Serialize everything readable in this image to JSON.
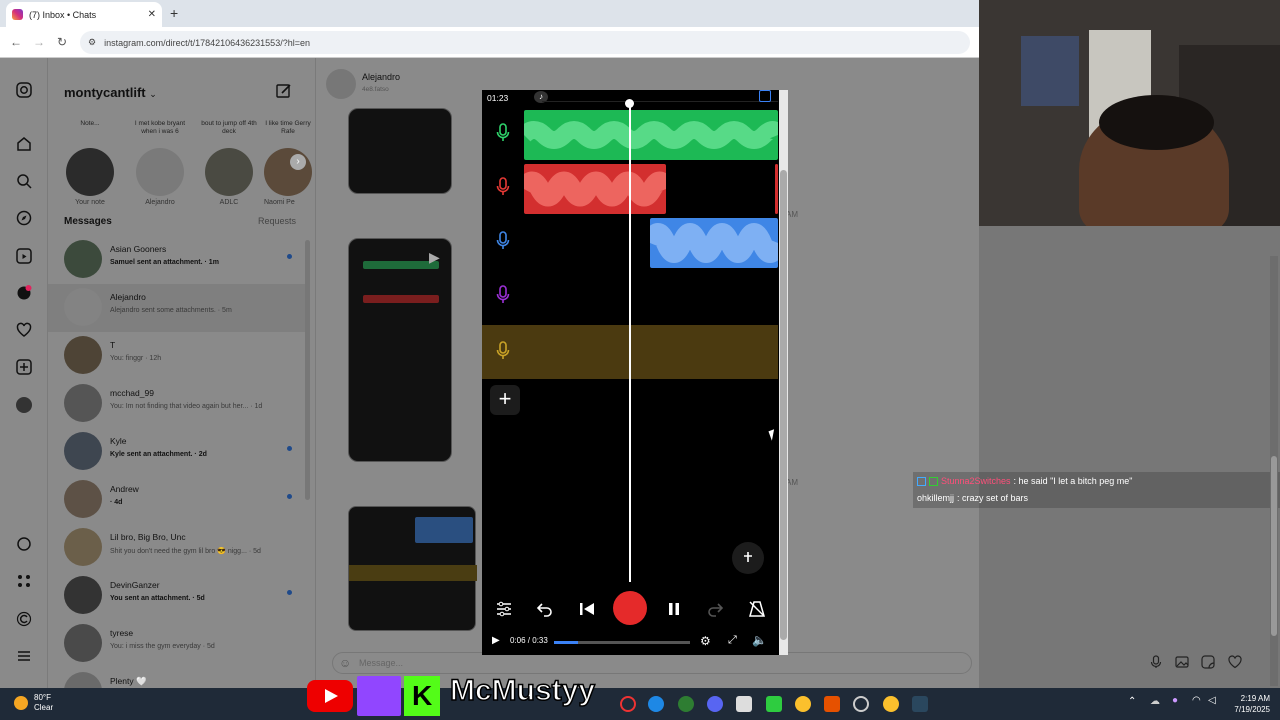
{
  "browser": {
    "tab_title": "(7) Inbox • Chats",
    "url": "instagram.com/direct/t/17842106436231553/?hl=en"
  },
  "sidebar": {
    "username": "montycantlift",
    "notes": [
      {
        "bubble": "Note...",
        "name": "Your note"
      },
      {
        "bubble": "I met kobe bryant when i was 6",
        "name": "Alejandro"
      },
      {
        "bubble": "bout to jump off 4th deck",
        "name": "ADLC"
      },
      {
        "bubble": "I like time Gerry Rafe",
        "name": "Naomi Pe"
      }
    ],
    "messages_label": "Messages",
    "requests_label": "Requests",
    "chats": [
      {
        "name": "Asian Gooners",
        "preview": "Samuel sent an attachment. · 1m",
        "unread": true
      },
      {
        "name": "Alejandro",
        "preview": "Alejandro sent some attachments. · 5m",
        "unread": false
      },
      {
        "name": "T",
        "preview": "You: finggr · 12h",
        "unread": false
      },
      {
        "name": "mcchad_99",
        "preview": "You: Im not finding that video again but her... · 1d",
        "unread": false
      },
      {
        "name": "Kyle",
        "preview": "Kyle sent an attachment. · 2d",
        "unread": true
      },
      {
        "name": "Andrew",
        "preview": "· 4d",
        "unread": true
      },
      {
        "name": "Lil bro, Big Bro, Unc",
        "preview": "Shit you don't need the gym lil bro 😎 nigg... · 5d",
        "unread": false
      },
      {
        "name": "DevinGanzer",
        "preview": "You sent an attachment. · 5d",
        "unread": true
      },
      {
        "name": "tyrese",
        "preview": "You: i miss the gym everyday · 5d",
        "unread": false
      },
      {
        "name": "Plenty 🤍",
        "preview": "",
        "unread": false
      }
    ]
  },
  "conversation": {
    "name": "Alejandro",
    "sub": "4e8.fatso",
    "timestamps": [
      "AM",
      "AM"
    ],
    "message_placeholder": "Message..."
  },
  "phone": {
    "time": "01:23",
    "tracks": [
      {
        "color": "#2fd36b",
        "clip_start": 0.0,
        "clip_end": 1.0
      },
      {
        "color": "#e53935",
        "clip_start": 0.0,
        "clip_end": 0.55
      },
      {
        "color": "#3f86e6",
        "clip_start": 0.5,
        "clip_end": 1.0
      },
      {
        "color": "#9b30d6",
        "clip_start": 0,
        "clip_end": 0
      },
      {
        "color": "#c9a227",
        "clip_start": 0,
        "clip_end": 0
      }
    ],
    "video_time": "0:06 / 0:33",
    "video_progress": 0.18
  },
  "twitch_chat": [
    {
      "user": "Stunna2Switches",
      "user_color": "#ff4f7a",
      "text": ": he said \"I let a bitch peg me\""
    },
    {
      "user": "ohkillemjj",
      "user_color": "#ffffff",
      "text": ": crazy set of bars"
    }
  ],
  "taskbar": {
    "temp": "80°F",
    "weather": "Clear",
    "time": "2:19 AM",
    "date": "7/19/2025"
  },
  "overlay": {
    "brand": "McMustyy"
  }
}
